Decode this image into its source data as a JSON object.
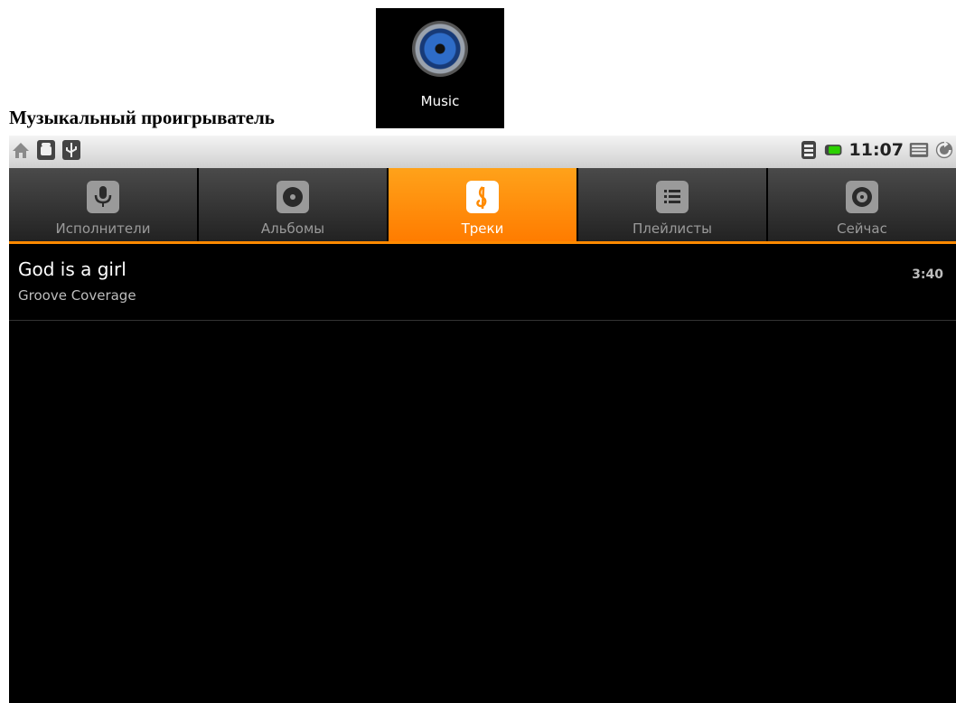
{
  "doc": {
    "title": "Музыкальный проигрыватель"
  },
  "app_icon": {
    "label": "Music",
    "icon": "speaker-icon"
  },
  "statusbar": {
    "time": "11:07",
    "left_icons": [
      "home-icon",
      "android-icon",
      "usb-icon"
    ],
    "right_icons": [
      "signal-icon",
      "battery-icon",
      "menu-icon",
      "sync-icon"
    ]
  },
  "tabs": [
    {
      "label": "Исполнители",
      "icon": "microphone-icon",
      "active": false
    },
    {
      "label": "Альбомы",
      "icon": "disc-icon",
      "active": false
    },
    {
      "label": "Треки",
      "icon": "music-note-icon",
      "active": true
    },
    {
      "label": "Плейлисты",
      "icon": "playlist-icon",
      "active": false
    },
    {
      "label": "Сейчас",
      "icon": "now-playing-icon",
      "active": false
    }
  ],
  "tracks": [
    {
      "title": "God is a girl",
      "artist": "Groove Coverage",
      "duration": "3:40"
    }
  ],
  "colors": {
    "accent": "#ff8a00",
    "background": "#000000"
  }
}
